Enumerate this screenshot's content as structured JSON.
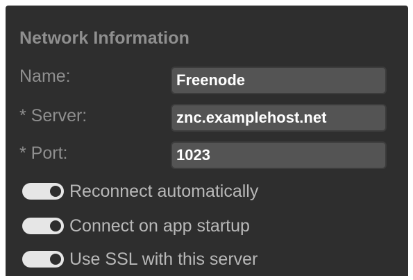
{
  "section": {
    "title": "Network Information"
  },
  "fields": [
    {
      "label": "Name:",
      "value": "Freenode"
    },
    {
      "label": "* Server:",
      "value": "znc.examplehost.net"
    },
    {
      "label": "* Port:",
      "value": "1023"
    }
  ],
  "toggles": [
    {
      "label": "Reconnect automatically",
      "on": true
    },
    {
      "label": "Connect on app startup",
      "on": true
    },
    {
      "label": "Use SSL with this server",
      "on": true
    }
  ],
  "colors": {
    "panel_bg": "#2e2e2e",
    "field_bg": "#545454",
    "label_text": "#8f8f8f",
    "toggle_text": "#b8b8b8",
    "toggle_on": "#e6e6e6"
  }
}
